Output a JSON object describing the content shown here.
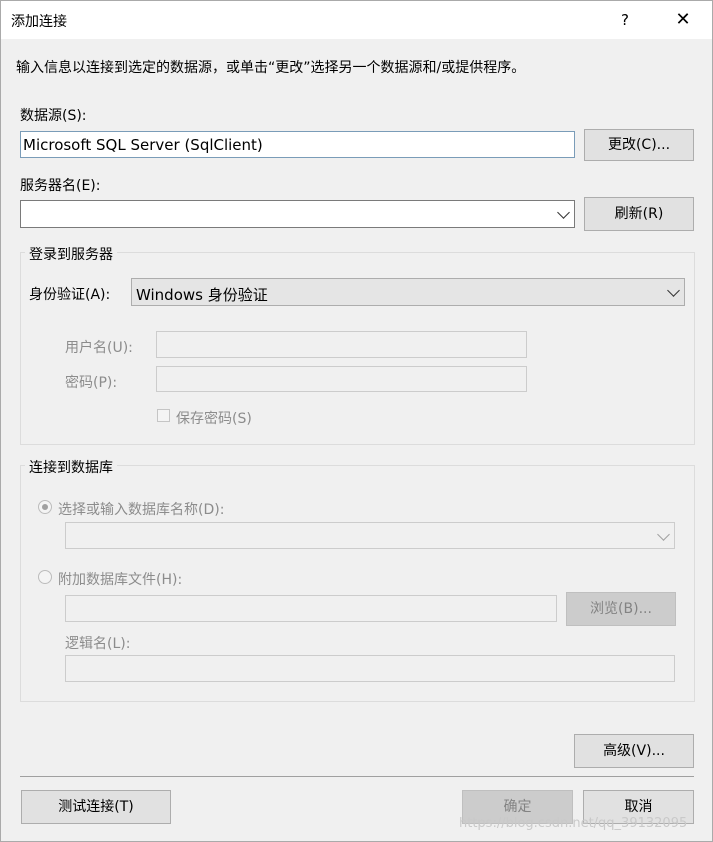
{
  "window": {
    "title": "添加连接",
    "help_glyph": "?",
    "close_glyph": "✕"
  },
  "instruction": "输入信息以连接到选定的数据源，或单击“更改”选择另一个数据源和/或提供程序。",
  "datasource": {
    "label": "数据源(S):",
    "value": "Microsoft SQL Server (SqlClient)",
    "change_button": "更改(C)..."
  },
  "server": {
    "label": "服务器名(E):",
    "value": "",
    "refresh_button": "刷新(R)"
  },
  "login_group": {
    "title": "登录到服务器",
    "auth_label": "身份验证(A):",
    "auth_value": "Windows 身份验证",
    "username_label": "用户名(U):",
    "username_value": "",
    "password_label": "密码(P):",
    "password_value": "",
    "save_password_label": "保存密码(S)",
    "save_password_checked": false
  },
  "db_group": {
    "title": "连接到数据库",
    "select_db_label": "选择或输入数据库名称(D):",
    "select_db_value": "",
    "attach_label": "附加数据库文件(H):",
    "attach_value": "",
    "browse_button": "浏览(B)...",
    "logical_name_label": "逻辑名(L):",
    "logical_name_value": ""
  },
  "advanced_button": "高级(V)...",
  "footer": {
    "test_button": "测试连接(T)",
    "ok_button": "确定",
    "cancel_button": "取消"
  },
  "watermark": "https://blog.csdn.net/qq_39132095"
}
